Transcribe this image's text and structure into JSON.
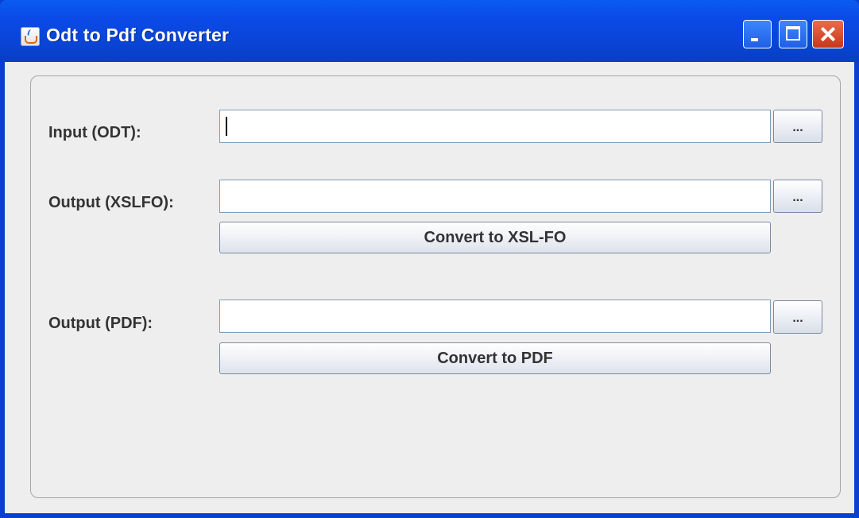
{
  "window": {
    "title": "Odt to Pdf Converter",
    "app_icon": "java-cup-icon",
    "controls": [
      "minimize-icon",
      "maximize-icon",
      "close-icon"
    ]
  },
  "form": {
    "input_odt": {
      "label": "Input (ODT):",
      "value": "",
      "browse_label": "..."
    },
    "output_xslfo": {
      "label": "Output (XSLFO):",
      "value": "",
      "browse_label": "...",
      "action_label": "Convert to XSL-FO"
    },
    "output_pdf": {
      "label": "Output (PDF):",
      "value": "",
      "browse_label": "...",
      "action_label": "Convert to PDF"
    }
  },
  "colors": {
    "titlebar": "#0b4ae6",
    "close_button": "#d9472a",
    "panel_background": "#eeeeee"
  }
}
